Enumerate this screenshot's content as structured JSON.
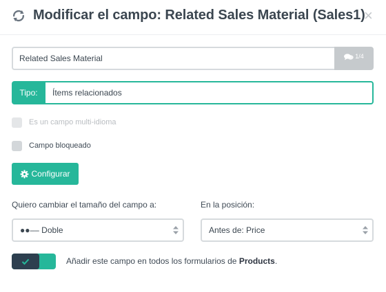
{
  "header": {
    "title": "Modificar el campo: Related Sales Material (Sales1)",
    "close_icon": "×"
  },
  "field_name": {
    "value": "Related Sales Material",
    "lang_counter": "1/4"
  },
  "tipo": {
    "label": "Tipo:",
    "value": "Ítems relacionados"
  },
  "checkboxes": {
    "multi_language": "Es un campo multi-idioma",
    "locked": "Campo bloqueado"
  },
  "config_button": "Configurar",
  "size": {
    "label": "Quiero cambiar el tamaño del campo a:",
    "selected": "●●‒‒ Doble"
  },
  "position": {
    "label": "En la posición:",
    "selected": "Antes de: Price"
  },
  "toggle": {
    "state": "on",
    "text_prefix": "Añadir este campo en todos los formularios de ",
    "text_bold": "Products",
    "text_suffix": "."
  },
  "colors": {
    "accent": "#26b79a",
    "dark": "#2d3f4f",
    "muted": "#c6cacd"
  }
}
